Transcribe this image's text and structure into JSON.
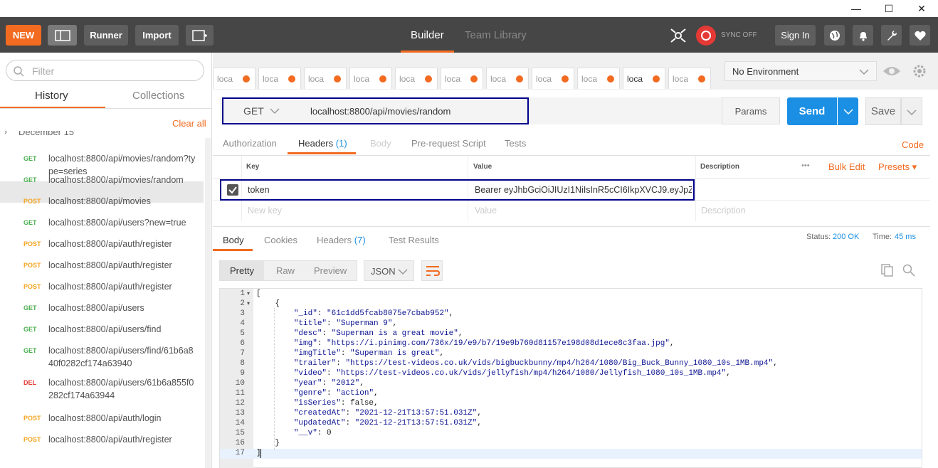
{
  "window": {
    "minimize": "—",
    "maximize": "☐",
    "close": "✕"
  },
  "topbar": {
    "new_label": "NEW",
    "runner_label": "Runner",
    "import_label": "Import",
    "tabs": [
      {
        "label": "Builder"
      },
      {
        "label": "Team Library"
      }
    ],
    "sync_label": "SYNC OFF",
    "signin_label": "Sign In"
  },
  "sidebar": {
    "filter_placeholder": "Filter",
    "tabs": [
      {
        "label": "History"
      },
      {
        "label": "Collections"
      }
    ],
    "clear_all": "Clear all",
    "group_label": "December 15",
    "items": [
      {
        "method": "GET",
        "url": "localhost:8800/api/movies/random?type=series"
      },
      {
        "method": "GET",
        "url": "localhost:8800/api/movies/random"
      },
      {
        "method": "POST",
        "url": "localhost:8800/api/movies"
      },
      {
        "method": "GET",
        "url": "localhost:8800/api/users?new=true"
      },
      {
        "method": "POST",
        "url": "localhost:8800/api/auth/register"
      },
      {
        "method": "POST",
        "url": "localhost:8800/api/auth/register"
      },
      {
        "method": "POST",
        "url": "localhost:8800/api/auth/register"
      },
      {
        "method": "GET",
        "url": "localhost:8800/api/users"
      },
      {
        "method": "GET",
        "url": "localhost:8800/api/users/find"
      },
      {
        "method": "GET",
        "url": "localhost:8800/api/users/find/61b6a840f0282cf174a63940"
      },
      {
        "method": "DEL",
        "url": "localhost:8800/api/users/61b6a855f0282cf174a63944"
      },
      {
        "method": "POST",
        "url": "localhost:8800/api/auth/login"
      },
      {
        "method": "POST",
        "url": "localhost:8800/api/auth/register"
      }
    ]
  },
  "request_tabs": [
    "loca",
    "loca",
    "loca",
    "loca",
    "loca",
    "loca",
    "loca",
    "loca",
    "loca",
    "loca",
    "loca"
  ],
  "environment": {
    "selected": "No Environment"
  },
  "request": {
    "method": "GET",
    "url": "localhost:8800/api/movies/random",
    "params_label": "Params",
    "send_label": "Send",
    "save_label": "Save"
  },
  "req_subtabs": {
    "authorization": "Authorization",
    "headers": "Headers",
    "headers_count": "(1)",
    "body": "Body",
    "prerequest": "Pre-request Script",
    "tests": "Tests",
    "code": "Code"
  },
  "headers_table": {
    "col_key": "Key",
    "col_value": "Value",
    "col_description": "Description",
    "dots": "•••",
    "bulk_edit": "Bulk Edit",
    "presets": "Presets ▾",
    "row": {
      "key": "token",
      "value": "Bearer eyJhbGciOiJIUzI1NiIsInR5cCI6IkpXVCJ9.eyJpZC..."
    },
    "new_key": "New key",
    "new_value": "Value",
    "new_description": "Description"
  },
  "response": {
    "tabs": {
      "body": "Body",
      "cookies": "Cookies",
      "headers": "Headers",
      "headers_count": "(7)",
      "test_results": "Test Results"
    },
    "status_label": "Status:",
    "status_value": "200 OK",
    "time_label": "Time:",
    "time_value": "45 ms",
    "view_modes": [
      "Pretty",
      "Raw",
      "Preview"
    ],
    "format": "JSON"
  },
  "code_lines": [
    {
      "n": "1",
      "t": "["
    },
    {
      "n": "2",
      "t": "    {"
    },
    {
      "n": "3",
      "t": "        \"_id\": \"61c1dd5fcab8075e7cbab952\","
    },
    {
      "n": "4",
      "t": "        \"title\": \"Superman 9\","
    },
    {
      "n": "5",
      "t": "        \"desc\": \"Superman is a great movie\","
    },
    {
      "n": "6",
      "t": "        \"img\": \"https://i.pinimg.com/736x/19/e9/b7/19e9b760d81157e198d08d1ece8c3faa.jpg\","
    },
    {
      "n": "7",
      "t": "        \"imgTitle\": \"Superman is great\","
    },
    {
      "n": "8",
      "t": "        \"trailer\": \"https://test-videos.co.uk/vids/bigbuckbunny/mp4/h264/1080/Big_Buck_Bunny_1080_10s_1MB.mp4\","
    },
    {
      "n": "9",
      "t": "        \"video\": \"https://test-videos.co.uk/vids/jellyfish/mp4/h264/1080/Jellyfish_1080_10s_1MB.mp4\","
    },
    {
      "n": "10",
      "t": "        \"year\": \"2012\","
    },
    {
      "n": "11",
      "t": "        \"genre\": \"action\","
    },
    {
      "n": "12",
      "t": "        \"isSeries\": false,"
    },
    {
      "n": "13",
      "t": "        \"createdAt\": \"2021-12-21T13:57:51.031Z\","
    },
    {
      "n": "14",
      "t": "        \"updatedAt\": \"2021-12-21T13:57:51.031Z\","
    },
    {
      "n": "15",
      "t": "        \"__v\": 0"
    },
    {
      "n": "16",
      "t": "    }"
    },
    {
      "n": "17",
      "t": "]"
    }
  ],
  "colors": {
    "accent": "#f26b21",
    "topbar": "#464646",
    "send": "#1a8fe3",
    "highlight": "#00008b",
    "get": "#4caf50",
    "post": "#f5a623",
    "del": "#e53935"
  }
}
